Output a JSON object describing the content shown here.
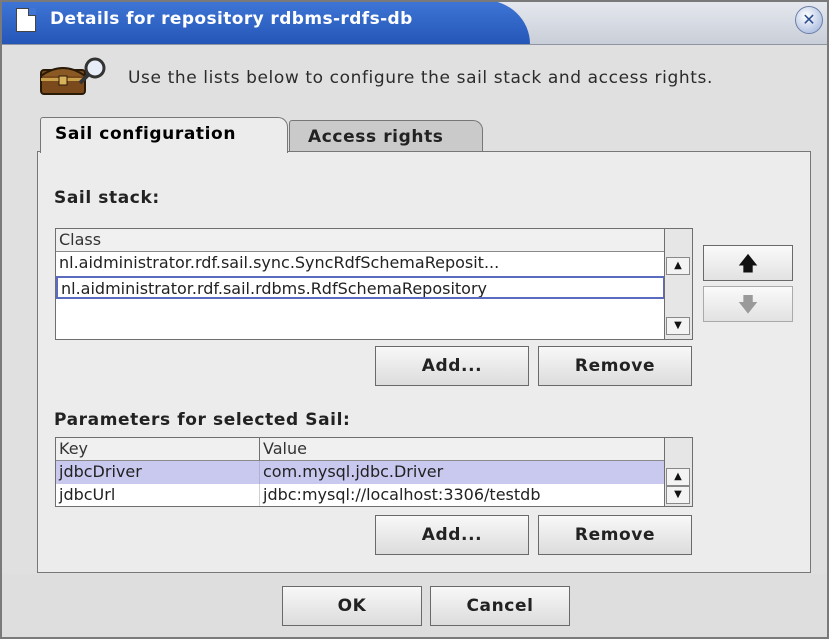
{
  "window": {
    "title": "Details for repository rdbms-rdfs-db",
    "close_glyph": "✕"
  },
  "header": {
    "icon": "treasure-chest-search-icon",
    "text": "Use the lists below to configure the sail stack and access rights."
  },
  "tabs": [
    {
      "label": "Sail configuration",
      "selected": true
    },
    {
      "label": "Access rights",
      "selected": false
    }
  ],
  "sail_stack": {
    "label": "Sail stack:",
    "column": "Class",
    "rows": [
      "nl.aidministrator.rdf.sail.sync.SyncRdfSchemaReposit...",
      "nl.aidministrator.rdf.sail.rdbms.RdfSchemaRepository"
    ],
    "move_up_glyph": "🡅",
    "move_down_glyph": "🡇",
    "add_label": "Add...",
    "remove_label": "Remove"
  },
  "parameters": {
    "label": "Parameters for selected Sail:",
    "columns": [
      "Key",
      "Value"
    ],
    "rows": [
      {
        "key": "jdbcDriver",
        "value": "com.mysql.jdbc.Driver"
      },
      {
        "key": "jdbcUrl",
        "value": "jdbc:mysql://localhost:3306/testdb"
      }
    ],
    "add_label": "Add...",
    "remove_label": "Remove"
  },
  "footer": {
    "ok_label": "OK",
    "cancel_label": "Cancel"
  },
  "colors": {
    "title_bar": "#2f63c6",
    "selected_row": "#c9c9f0",
    "focus_border": "#5b6bbf"
  }
}
